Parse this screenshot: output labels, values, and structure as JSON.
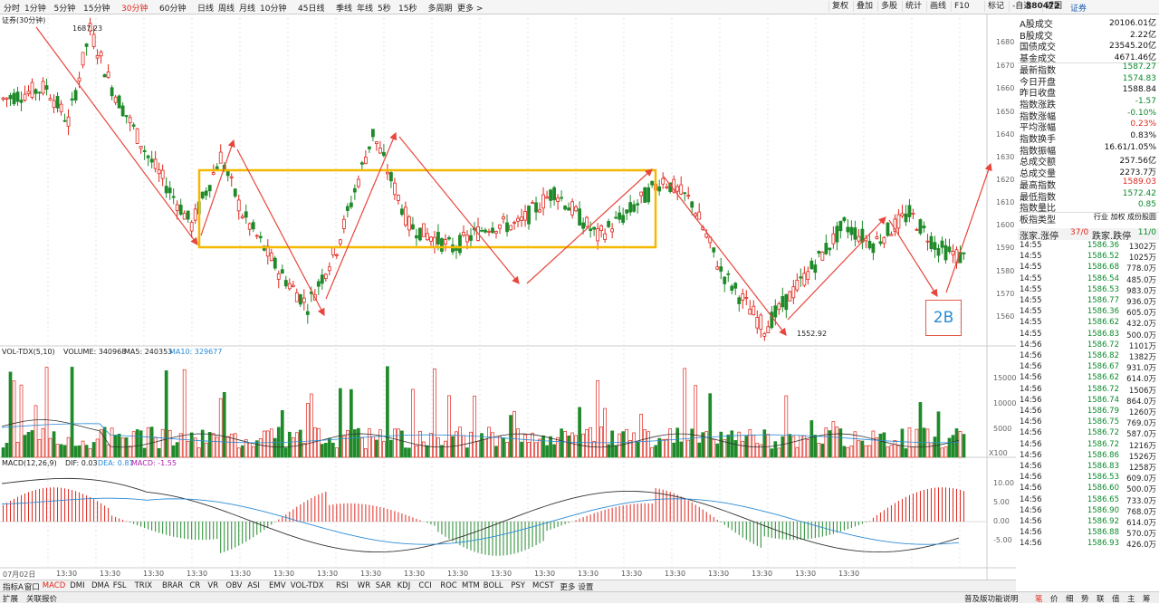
{
  "toolbar": {
    "periods": [
      "分时",
      "1分钟",
      "5分钟",
      "15分钟",
      "30分钟",
      "60分钟",
      "日线",
      "周线",
      "月线",
      "10分钟",
      "45日线",
      "季线",
      "年线",
      "5秒",
      "15秒",
      "多周期",
      "更多 >"
    ],
    "active_period": "30分钟",
    "right_buttons": [
      "复权",
      "叠加",
      "多股",
      "统计",
      "画线",
      "F10",
      "标记",
      "-自选",
      "返回"
    ],
    "code": "880472",
    "name": "证券"
  },
  "main_chart": {
    "label": "证券(30分钟)",
    "high_label": "1687.23",
    "low_label": "1552.92",
    "y_ticks": [
      "1680",
      "1670",
      "1660",
      "1650",
      "1640",
      "1630",
      "1620",
      "1610",
      "1600",
      "1590",
      "1580",
      "1570",
      "1560"
    ],
    "badge_text": "2B"
  },
  "volume_chart": {
    "label": "VOL-TDX(5,10)",
    "volume_text": "VOLUME: 340968",
    "ma5_text": "MA5: 240353",
    "ma10_text": "MA10: 329677",
    "y_ticks": [
      "15000",
      "10000",
      "5000"
    ],
    "unit": "X100"
  },
  "macd_chart": {
    "label": "MACD(12,26,9)",
    "dif_text": "DIF: 0.03",
    "dea_text": "DEA: 0.81",
    "macd_text": "MACD: -1.55",
    "y_ticks": [
      "10.00",
      "5.00",
      "0.00",
      "-5.00"
    ]
  },
  "time_axis": [
    "07月02日",
    "13:30",
    "13:30",
    "13:30",
    "13:30",
    "13:30",
    "13:30",
    "13:30",
    "13:30",
    "13:30",
    "13:30",
    "13:30",
    "13:30",
    "13:30",
    "13:30",
    "13:30",
    "13:30",
    "13:30",
    "13:30",
    "13:30"
  ],
  "info_panel": {
    "rows": [
      {
        "k": "A股成交",
        "v": "20106.01亿",
        "c": ""
      },
      {
        "k": "B股成交",
        "v": "2.22亿",
        "c": ""
      },
      {
        "k": "国债成交",
        "v": "23545.20亿",
        "c": ""
      },
      {
        "k": "基金成交",
        "v": "4671.46亿",
        "c": ""
      },
      {
        "k": "最新指数",
        "v": "1587.27",
        "c": "green"
      },
      {
        "k": "今日开盘",
        "v": "1574.83",
        "c": "green"
      },
      {
        "k": "昨日收盘",
        "v": "1588.84",
        "c": ""
      },
      {
        "k": "指数涨跌",
        "v": "-1.57",
        "c": "green"
      },
      {
        "k": "指数涨幅",
        "v": "-0.10%",
        "c": "green"
      },
      {
        "k": "平均涨幅",
        "v": "0.23%",
        "c": "red"
      },
      {
        "k": "指数换手",
        "v": "0.83%",
        "c": ""
      },
      {
        "k": "指数振幅",
        "v": "16.61/1.05%",
        "c": ""
      },
      {
        "k": "总成交额",
        "v": "257.56亿",
        "c": ""
      },
      {
        "k": "总成交量",
        "v": "2273.7万",
        "c": ""
      },
      {
        "k": "最高指数",
        "v": "1589.03",
        "c": "red"
      },
      {
        "k": "最低指数",
        "v": "1572.42",
        "c": "green"
      },
      {
        "k": "指数量比",
        "v": "0.85",
        "c": "green"
      },
      {
        "k": "板指类型",
        "v": "行业 加权 成份股圆",
        "c": ""
      }
    ],
    "updown_label": "涨家.涨停",
    "updown_value": "37/0",
    "down_label": "跌家.跌停",
    "down_value": "11/0"
  },
  "ticks": [
    {
      "t": "14:55",
      "p": "1586.36",
      "q": "1302万"
    },
    {
      "t": "14:55",
      "p": "1586.52",
      "q": "1025万"
    },
    {
      "t": "14:55",
      "p": "1586.68",
      "q": "778.0万"
    },
    {
      "t": "14:55",
      "p": "1586.54",
      "q": "485.0万"
    },
    {
      "t": "14:55",
      "p": "1586.53",
      "q": "983.0万"
    },
    {
      "t": "14:55",
      "p": "1586.77",
      "q": "936.0万"
    },
    {
      "t": "14:55",
      "p": "1586.36",
      "q": "605.0万"
    },
    {
      "t": "14:55",
      "p": "1586.62",
      "q": "432.0万"
    },
    {
      "t": "14:55",
      "p": "1586.83",
      "q": "500.0万"
    },
    {
      "t": "14:56",
      "p": "1586.72",
      "q": "1101万"
    },
    {
      "t": "14:56",
      "p": "1586.82",
      "q": "1382万"
    },
    {
      "t": "14:56",
      "p": "1586.67",
      "q": "931.0万"
    },
    {
      "t": "14:56",
      "p": "1586.62",
      "q": "614.0万"
    },
    {
      "t": "14:56",
      "p": "1586.72",
      "q": "1506万"
    },
    {
      "t": "14:56",
      "p": "1586.74",
      "q": "864.0万"
    },
    {
      "t": "14:56",
      "p": "1586.79",
      "q": "1260万"
    },
    {
      "t": "14:56",
      "p": "1586.75",
      "q": "769.0万"
    },
    {
      "t": "14:56",
      "p": "1586.72",
      "q": "587.0万"
    },
    {
      "t": "14:56",
      "p": "1586.72",
      "q": "1216万"
    },
    {
      "t": "14:56",
      "p": "1586.86",
      "q": "1526万"
    },
    {
      "t": "14:56",
      "p": "1586.83",
      "q": "1258万"
    },
    {
      "t": "14:56",
      "p": "1586.53",
      "q": "609.0万"
    },
    {
      "t": "14:56",
      "p": "1586.60",
      "q": "500.0万"
    },
    {
      "t": "14:56",
      "p": "1586.65",
      "q": "733.0万"
    },
    {
      "t": "14:56",
      "p": "1586.90",
      "q": "768.0万"
    },
    {
      "t": "14:56",
      "p": "1586.92",
      "q": "614.0万"
    },
    {
      "t": "14:56",
      "p": "1586.88",
      "q": "570.0万"
    },
    {
      "t": "14:56",
      "p": "1586.93",
      "q": "426.0万"
    }
  ],
  "indicator_tabs": [
    "指标A",
    "窗口",
    "MACD",
    "DMI",
    "DMA",
    "FSL",
    "TRIX",
    "BRAR",
    "CR",
    "VR",
    "OBV",
    "ASI",
    "EMV",
    "VOL-TDX",
    "RSI",
    "WR",
    "SAR",
    "KDJ",
    "CCI",
    "ROC",
    "MTM",
    "BOLL",
    "PSY",
    "MCST",
    "更多",
    "设置"
  ],
  "active_tab": "MACD",
  "status_left": [
    "扩展",
    "关联报价"
  ],
  "status_right": [
    "普及版功能说明",
    "笔",
    "价",
    "细",
    "势",
    "联",
    "值",
    "主",
    "筹"
  ],
  "colors": {
    "up": "#e0261c",
    "down": "#1f8a2a",
    "box": "#f5b800",
    "arrow": "#e8463c",
    "ma5": "#333333",
    "ma10": "#2a8bd5"
  }
}
